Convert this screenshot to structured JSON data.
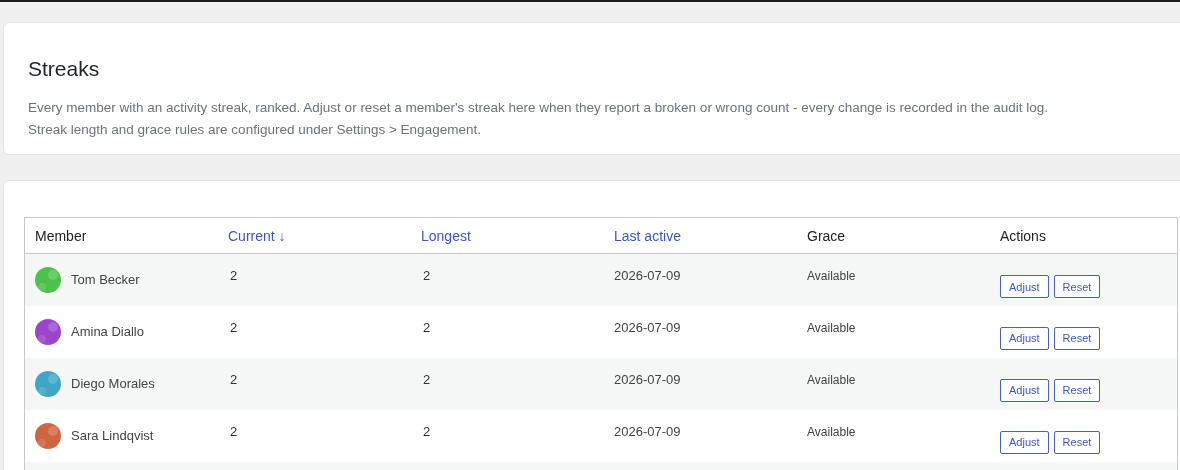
{
  "header": {
    "title": "Streaks",
    "description_lines": [
      "Every member with an activity streak, ranked. Adjust or reset a member's streak here when they report a broken or wrong count - every change is recorded in the audit log.",
      "Streak length and grace rules are configured under Settings > Engagement."
    ]
  },
  "table": {
    "columns": [
      {
        "label": "Member",
        "sortable": false
      },
      {
        "label": "Current ↓",
        "sortable": true
      },
      {
        "label": "Longest",
        "sortable": true
      },
      {
        "label": "Last active",
        "sortable": true
      },
      {
        "label": "Grace",
        "sortable": false
      },
      {
        "label": "Actions",
        "sortable": false
      }
    ],
    "rows": [
      {
        "name": "Tom Becker",
        "color": "#4cc24c",
        "current": "2",
        "longest": "2",
        "last_active": "2026-07-09",
        "grace": "Available",
        "actions": [
          "Adjust",
          "Reset"
        ]
      },
      {
        "name": "Amina Diallo",
        "color": "#9a45cc",
        "current": "2",
        "longest": "2",
        "last_active": "2026-07-09",
        "grace": "Available",
        "actions": [
          "Adjust",
          "Reset"
        ]
      },
      {
        "name": "Diego Morales",
        "color": "#3fa6c6",
        "current": "2",
        "longest": "2",
        "last_active": "2026-07-09",
        "grace": "Available",
        "actions": [
          "Adjust",
          "Reset"
        ]
      },
      {
        "name": "Sara Lindqvist",
        "color": "#cf6440",
        "current": "2",
        "longest": "2",
        "last_active": "2026-07-09",
        "grace": "Available",
        "actions": [
          "Adjust",
          "Reset"
        ]
      }
    ]
  }
}
